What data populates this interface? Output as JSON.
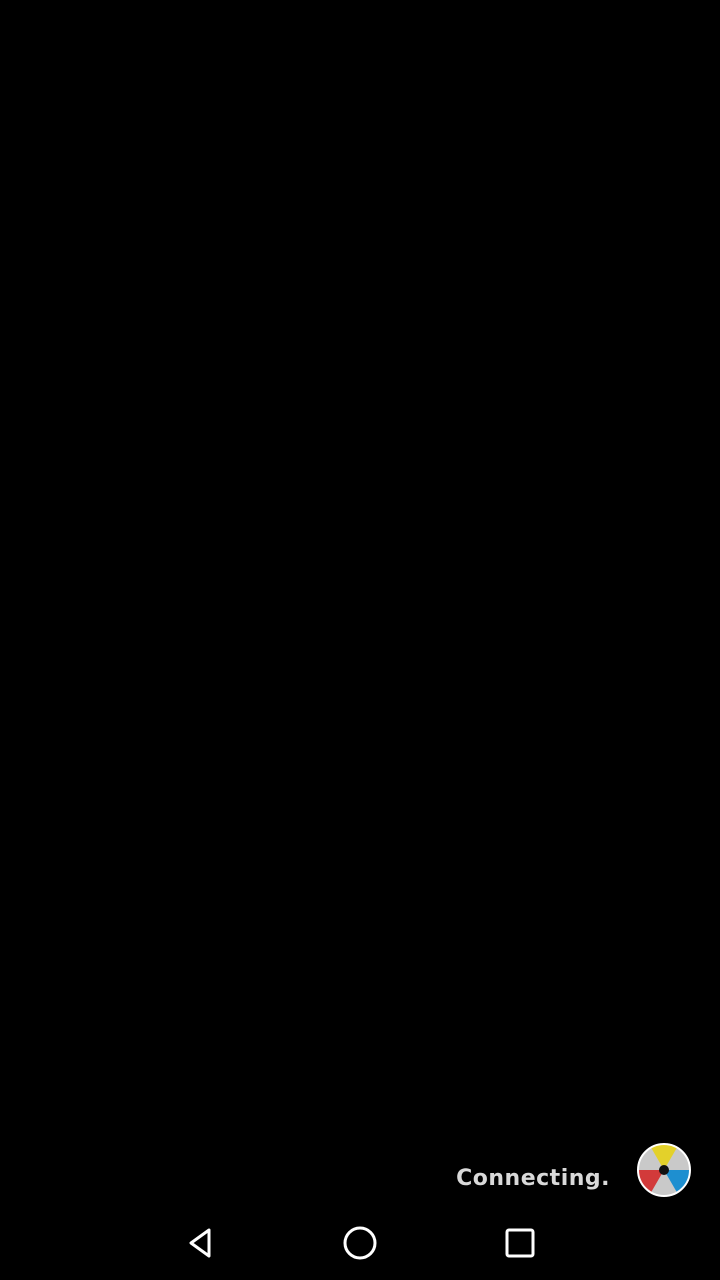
{
  "status": {
    "text": "Connecting.",
    "icon": "color-wheel-icon"
  },
  "colors": {
    "background": "#000000",
    "status_text": "#d9d9d9",
    "wheel_yellow": "#e3d12a",
    "wheel_blue": "#1e8fd0",
    "wheel_red": "#d23a3a",
    "wheel_gray": "#c9c9c9",
    "nav_icon": "#ffffff"
  },
  "navigation": {
    "back_icon": "back-triangle-icon",
    "home_icon": "home-circle-icon",
    "recents_icon": "recents-square-icon"
  }
}
